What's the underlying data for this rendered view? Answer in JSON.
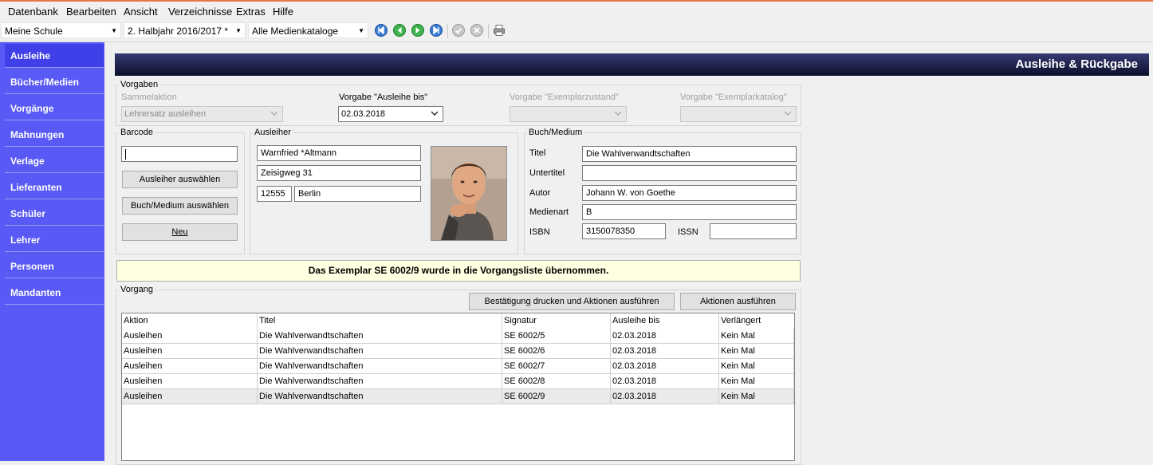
{
  "menu": {
    "items": [
      {
        "label": "Datenbank"
      },
      {
        "label": "Bearbeiten"
      },
      {
        "label": "Ansicht"
      },
      {
        "label": "Verzeichnisse"
      },
      {
        "label": "Extras"
      },
      {
        "label": "Hilfe"
      }
    ]
  },
  "toolbar": {
    "school": "Meine Schule",
    "term": "2. Halbjahr 2016/2017 *",
    "catalog": "Alle Medienkataloge",
    "icons": [
      "first-record-icon",
      "previous-record-icon",
      "next-record-icon",
      "last-record-icon",
      "confirm-icon",
      "cancel-icon",
      "print-icon"
    ]
  },
  "sidebar": {
    "items": [
      {
        "label": "Ausleihe"
      },
      {
        "label": "Bücher/Medien"
      },
      {
        "label": "Vorgänge"
      },
      {
        "label": "Mahnungen"
      },
      {
        "label": "Verlage"
      },
      {
        "label": "Lieferanten"
      },
      {
        "label": "Schüler"
      },
      {
        "label": "Lehrer"
      },
      {
        "label": "Personen"
      },
      {
        "label": "Mandanten"
      }
    ],
    "active": "Ausleihe"
  },
  "header": {
    "title": "Ausleihe & Rückgabe"
  },
  "vorgaben": {
    "group_label": "Vorgaben",
    "sammelaktion_label": "Sammelaktion",
    "sammelaktion_value": "Lehrersatz ausleihen",
    "ausleihe_bis_label": "Vorgabe \"Ausleihe bis\"",
    "ausleihe_bis_value": "02.03.2018",
    "zustand_label": "Vorgabe \"Exemplarzustand\"",
    "katalog_label": "Vorgabe \"Exemplarkatalog\""
  },
  "barcode": {
    "group_label": "Barcode",
    "value": "",
    "select_borrower": "Ausleiher auswählen",
    "select_medium": "Buch/Medium auswählen",
    "new": "Neu"
  },
  "ausleiher": {
    "group_label": "Ausleiher",
    "name": "Warnfried *Altmann",
    "street": "Zeisigweg 31",
    "zip": "12555",
    "city": "Berlin"
  },
  "medium": {
    "group_label": "Buch/Medium",
    "title_label": "Titel",
    "title": "Die Wahlverwandtschaften",
    "subtitle_label": "Untertitel",
    "subtitle": "",
    "author_label": "Autor",
    "author": "Johann W. von Goethe",
    "type_label": "Medienart",
    "type": "B",
    "isbn_label": "ISBN",
    "isbn": "3150078350",
    "issn_label": "ISSN",
    "issn": ""
  },
  "notice": "Das Exemplar SE 6002/9 wurde in die Vorgangsliste übernommen.",
  "vorgang": {
    "group_label": "Vorgang",
    "print_button": "Bestätigung drucken und Aktionen ausführen",
    "execute_button": "Aktionen ausführen",
    "columns": [
      "Aktion",
      "Titel",
      "Signatur",
      "Ausleihe bis",
      "Verlängert"
    ],
    "rows": [
      [
        "Ausleihen",
        "Die Wahlverwandtschaften",
        "SE 6002/5",
        "02.03.2018",
        "Kein Mal"
      ],
      [
        "Ausleihen",
        "Die Wahlverwandtschaften",
        "SE 6002/6",
        "02.03.2018",
        "Kein Mal"
      ],
      [
        "Ausleihen",
        "Die Wahlverwandtschaften",
        "SE 6002/7",
        "02.03.2018",
        "Kein Mal"
      ],
      [
        "Ausleihen",
        "Die Wahlverwandtschaften",
        "SE 6002/8",
        "02.03.2018",
        "Kein Mal"
      ],
      [
        "Ausleihen",
        "Die Wahlverwandtschaften",
        "SE 6002/9",
        "02.03.2018",
        "Kein Mal"
      ]
    ],
    "selected_row": 4
  },
  "colors": {
    "sidebar": "#5959f5",
    "sidebar_active": "#4040e8",
    "header_dark": "#0c0f2a",
    "notice_bg": "#ffffe1"
  }
}
